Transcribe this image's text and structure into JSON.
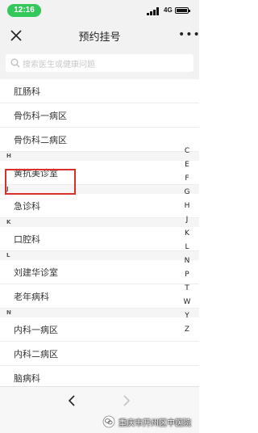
{
  "status": {
    "time": "12:16",
    "network": "4G"
  },
  "nav": {
    "title": "预约挂号"
  },
  "search": {
    "placeholder": "搜索医生或健康问题"
  },
  "list": [
    {
      "type": "item",
      "label": "肛肠科"
    },
    {
      "type": "item",
      "label": "骨伤科一病区"
    },
    {
      "type": "item",
      "label": "骨伤科二病区"
    },
    {
      "type": "section",
      "label": "H"
    },
    {
      "type": "item",
      "label": "黄抗美诊室"
    },
    {
      "type": "section",
      "label": "J"
    },
    {
      "type": "item",
      "label": "急诊科"
    },
    {
      "type": "section",
      "label": "K"
    },
    {
      "type": "item",
      "label": "口腔科"
    },
    {
      "type": "section",
      "label": "L"
    },
    {
      "type": "item",
      "label": "刘建华诊室"
    },
    {
      "type": "item",
      "label": "老年病科"
    },
    {
      "type": "section",
      "label": "N"
    },
    {
      "type": "item",
      "label": "内科一病区"
    },
    {
      "type": "item",
      "label": "内科二病区"
    },
    {
      "type": "item",
      "label": "脑病科"
    }
  ],
  "index_letters": [
    "C",
    "E",
    "F",
    "G",
    "H",
    "J",
    "K",
    "L",
    "N",
    "P",
    "T",
    "W",
    "Y",
    "Z"
  ],
  "watermark": {
    "text": "重庆市开州区中医院"
  },
  "colors": {
    "highlight": "#d9302c",
    "time_pill": "#34c759"
  }
}
